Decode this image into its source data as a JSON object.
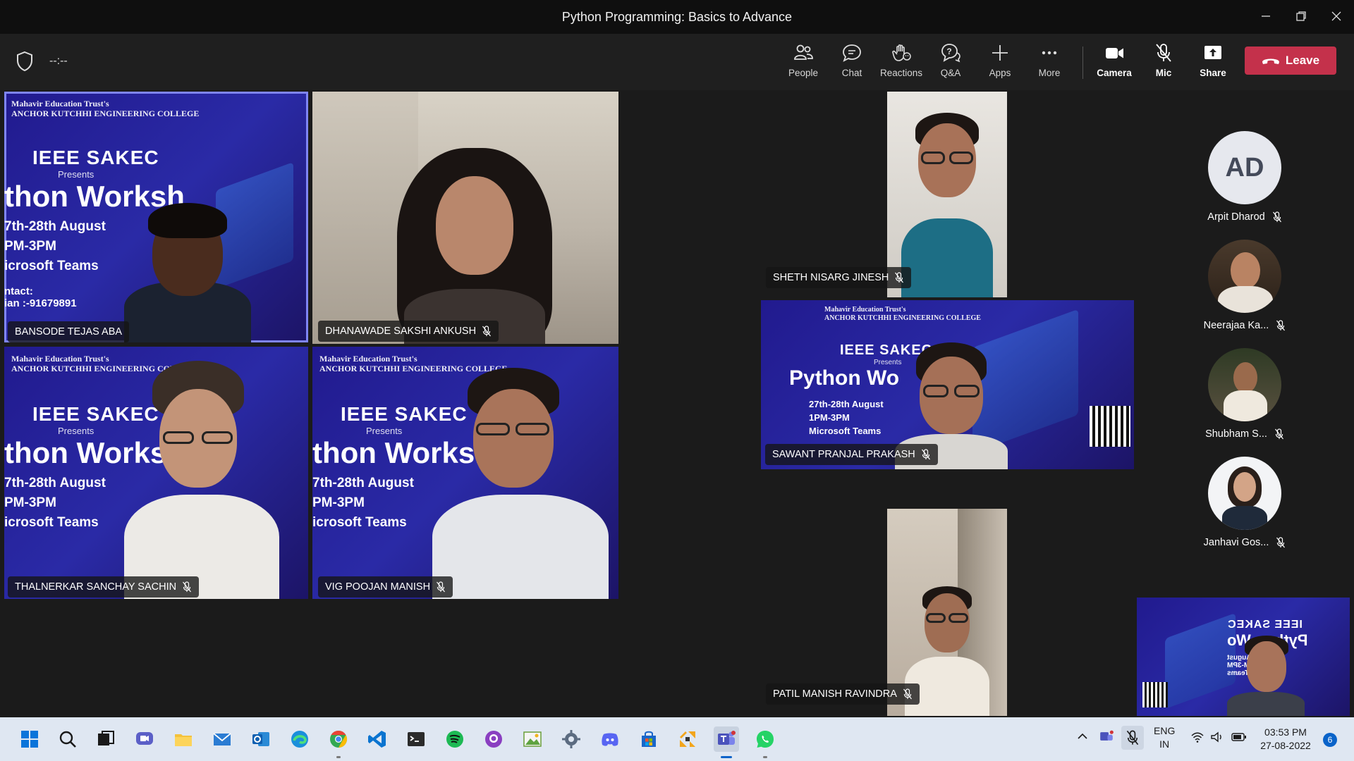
{
  "window": {
    "title": "Python Programming: Basics to Advance"
  },
  "meeting": {
    "timer": "--:--"
  },
  "toolbar": {
    "people": "People",
    "chat": "Chat",
    "reactions": "Reactions",
    "qa": "Q&A",
    "apps": "Apps",
    "more": "More",
    "camera": "Camera",
    "mic": "Mic",
    "share": "Share",
    "leave": "Leave"
  },
  "poster": {
    "org_line1": "Mahavir Education Trust's",
    "org_line2": "ANCHOR KUTCHHI ENGINEERING COLLEGE",
    "ieee": "IEEE SAKEC",
    "presents": "Presents",
    "workshop_cut": "thon Worksh",
    "python_cut": "Python Wo",
    "date_cut": "7th-28th August",
    "time_cut": "PM-3PM",
    "teams_cut": "icrosoft Teams",
    "contact_cut": "ntact:",
    "phone_cut": "ian :-91679891",
    "date": "27th-28th August",
    "time": "1PM-3PM",
    "teams": "Microsoft Teams"
  },
  "participants": [
    {
      "name": "BANSODE TEJAS ABA"
    },
    {
      "name": "DHANAWADE SAKSHI ANKUSH"
    },
    {
      "name": "SHETH NISARG JINESH"
    },
    {
      "name": "SAWANT PRANJAL PRAKASH"
    },
    {
      "name": "THALNERKAR SANCHAY SACHIN"
    },
    {
      "name": "VIG POOJAN MANISH"
    },
    {
      "name": "PATIL MANISH RAVINDRA"
    }
  ],
  "sidebar": [
    {
      "initials": "AD",
      "name": "Arpit Dharod"
    },
    {
      "name": "Neerajaa Ka..."
    },
    {
      "name": "Shubham S..."
    },
    {
      "name": "Janhavi Gos..."
    }
  ],
  "tray": {
    "lang1": "ENG",
    "lang2": "IN",
    "time": "03:53 PM",
    "date": "27-08-2022",
    "notifications": "6"
  },
  "colors": {
    "leave": "#c4314b",
    "active_outline": "#7f85f5",
    "poster_bg": "#2a2aa6"
  }
}
